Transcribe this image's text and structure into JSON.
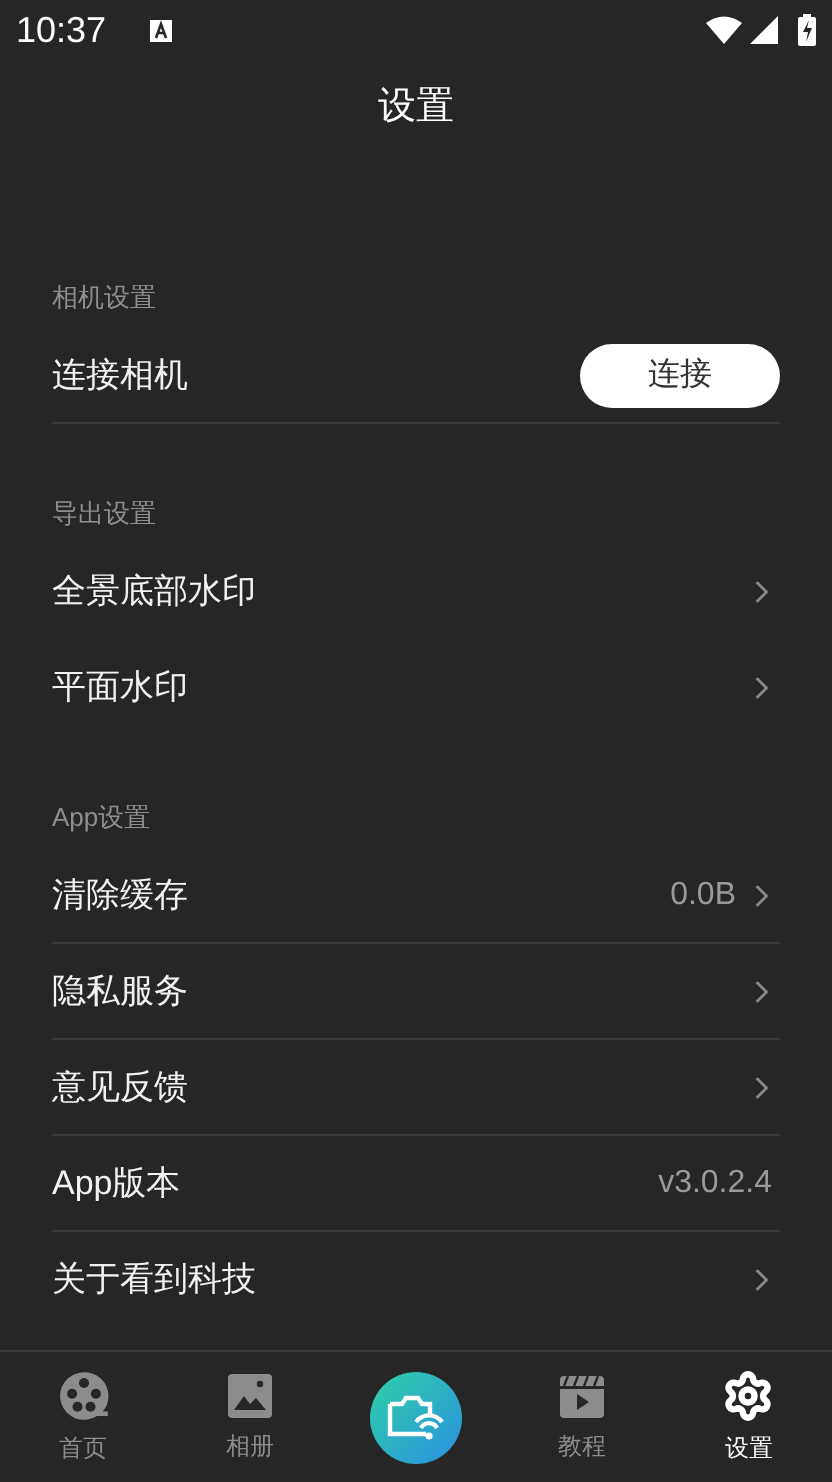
{
  "status_bar": {
    "time": "10:37"
  },
  "title": "设置",
  "sections": [
    {
      "header": "相机设置",
      "rows": [
        {
          "kind": "button",
          "label": "连接相机",
          "button": "连接",
          "divider": true
        }
      ]
    },
    {
      "header": "导出设置",
      "rows": [
        {
          "kind": "link",
          "label": "全景底部水印",
          "divider": false
        },
        {
          "kind": "link",
          "label": "平面水印",
          "divider": false
        }
      ]
    },
    {
      "header": "App设置",
      "rows": [
        {
          "kind": "link",
          "label": "清除缓存",
          "value": "0.0B",
          "divider": true
        },
        {
          "kind": "link",
          "label": "隐私服务",
          "divider": true
        },
        {
          "kind": "link",
          "label": "意见反馈",
          "divider": true
        },
        {
          "kind": "value",
          "label": "App版本",
          "value": "v3.0.2.4",
          "divider": true
        },
        {
          "kind": "link",
          "label": "关于看到科技",
          "divider": false
        }
      ]
    }
  ],
  "nav": [
    {
      "kind": "tab",
      "label": "首页",
      "selected": false
    },
    {
      "kind": "tab",
      "label": "相册",
      "selected": false
    },
    {
      "kind": "center"
    },
    {
      "kind": "tab",
      "label": "教程",
      "selected": false
    },
    {
      "kind": "tab",
      "label": "设置",
      "selected": true
    }
  ]
}
